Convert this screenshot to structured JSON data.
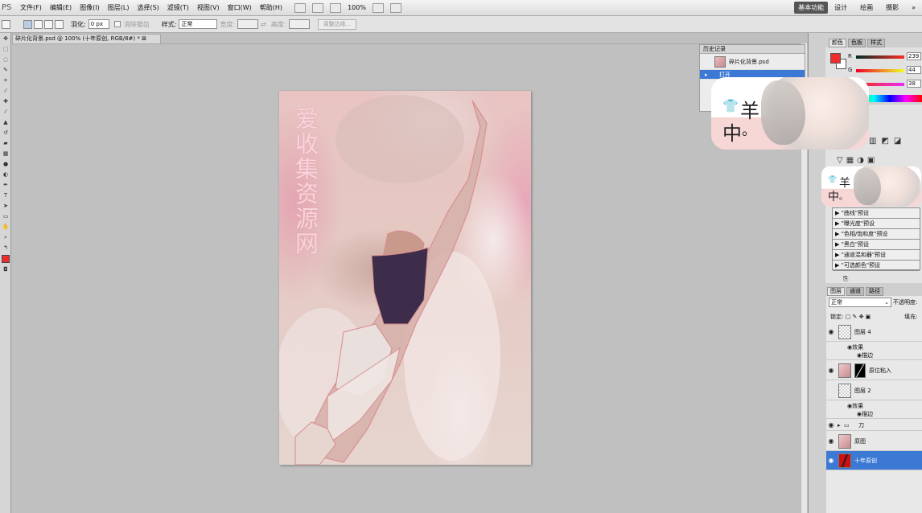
{
  "menubar": {
    "logo": "PS",
    "menus": [
      "文件(F)",
      "编辑(E)",
      "图像(I)",
      "图层(L)",
      "选择(S)",
      "滤镜(T)",
      "视图(V)",
      "窗口(W)",
      "帮助(H)"
    ],
    "zoom": "100%",
    "workspaces": {
      "active": "基本功能",
      "others": [
        "设计",
        "绘画",
        "摄影"
      ],
      "more": "»"
    }
  },
  "options": {
    "feather_label": "羽化:",
    "feather_value": "0 px",
    "antialias_label": "消除锯齿",
    "style_label": "样式:",
    "style_value": "正常",
    "width_label": "宽度:",
    "height_label": "高度:",
    "refine_edge": "调整边缘..."
  },
  "document": {
    "tab_title": "碎片化背景.psd @ 100% (十年原创, RGB/8#) *",
    "watermark": "爱收集资源网"
  },
  "history": {
    "title": "历史记录",
    "snapshot_label": "碎片化背景.psd",
    "open_label": "打开"
  },
  "sticker": {
    "glyph1": "羊",
    "glyph2": "中",
    "glyph3": "。"
  },
  "color_panel": {
    "tabs": [
      "颜色",
      "色板",
      "样式"
    ],
    "r_label": "R",
    "g_label": "G",
    "b_label": "B",
    "r": "239",
    "g": "44",
    "b": "38",
    "foreground": "#ef2c26",
    "background": "#ffffff"
  },
  "adjustments": {
    "presets": [
      "\"曲线\"预设",
      "\"曝光度\"预设",
      "\"色相/饱和度\"预设",
      "\"黑白\"预设",
      "\"通道混和器\"预设",
      "\"可选颜色\"预设"
    ]
  },
  "layers": {
    "tabs": [
      "图层",
      "通道",
      "路径"
    ],
    "blend_mode": "正常",
    "opacity_label": "不透明度:",
    "lock_label": "锁定:",
    "fill_label": "填充:",
    "items": [
      {
        "name": "图层 4",
        "effects_label": "效果",
        "effect": "描边"
      },
      {
        "name": "原位粘入"
      },
      {
        "name": "图层 2",
        "effects_label": "效果",
        "effect": "描边"
      },
      {
        "name": "刀"
      },
      {
        "name": "原图"
      },
      {
        "name": "十年原创"
      }
    ]
  }
}
